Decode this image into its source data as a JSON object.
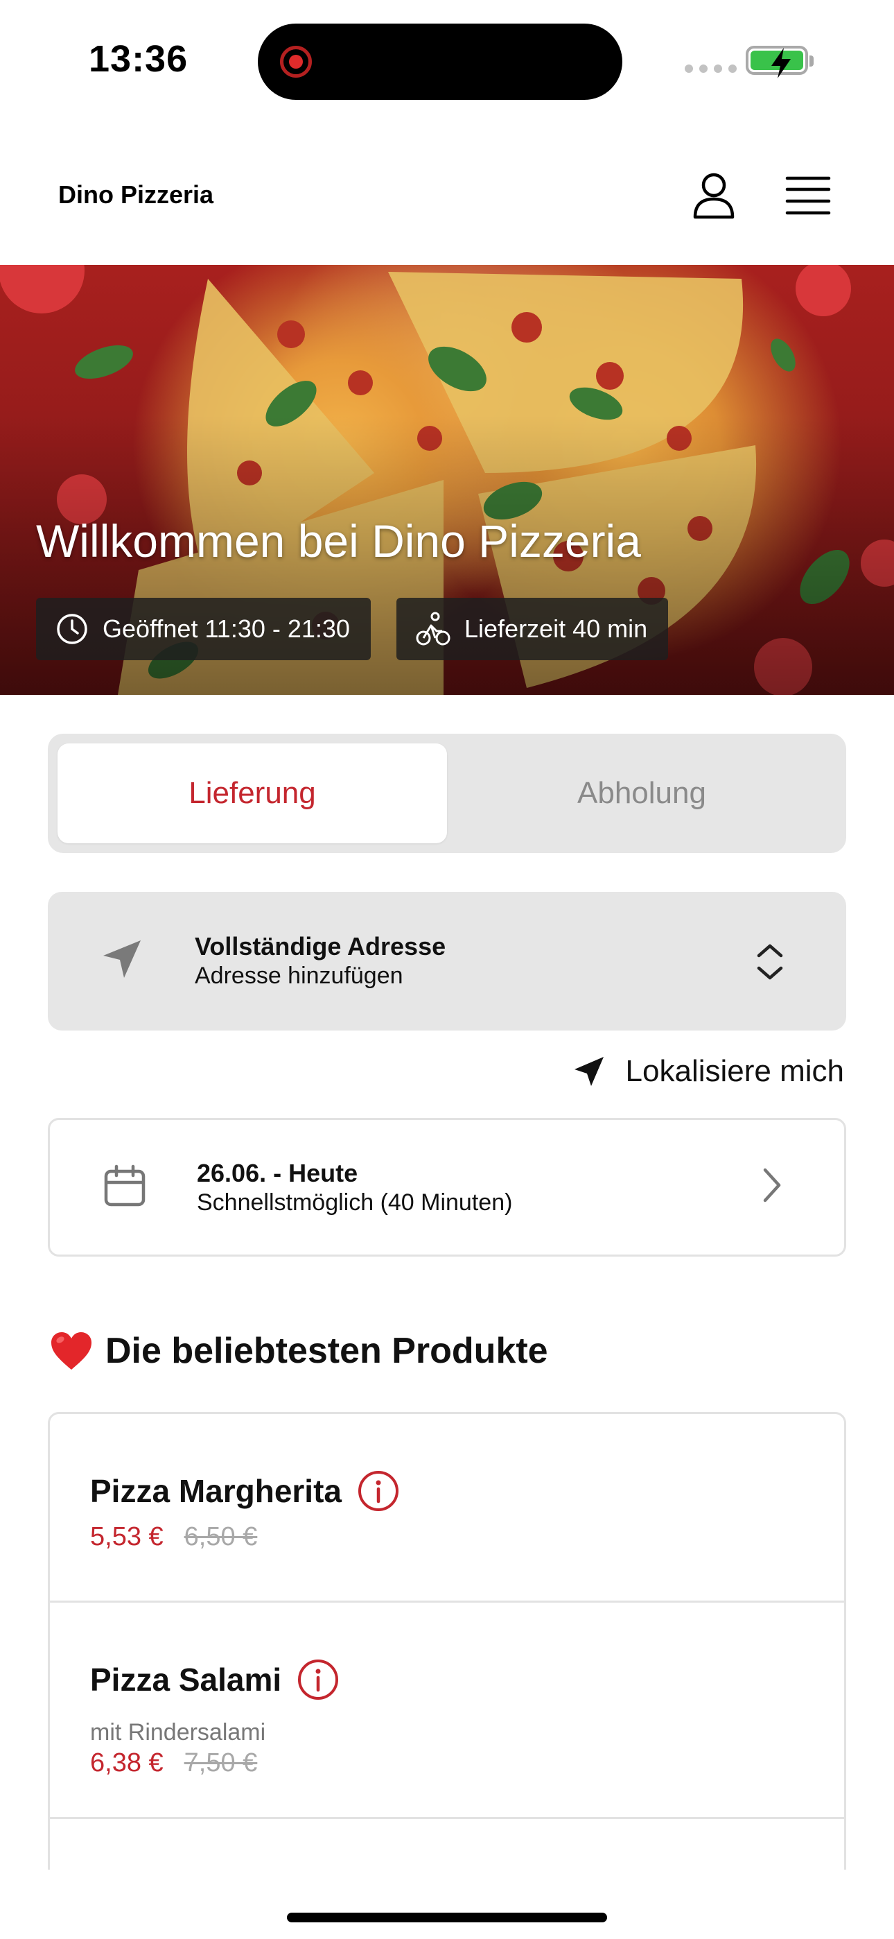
{
  "status_bar": {
    "time": "13:36"
  },
  "header": {
    "brand": "Dino Pizzeria"
  },
  "hero": {
    "title": "Willkommen bei Dino Pizzeria",
    "hours": "Geöffnet 11:30 - 21:30",
    "delivery_time": "Lieferzeit 40 min"
  },
  "order_mode": {
    "options": [
      "Lieferung",
      "Abholung"
    ],
    "selected": "Lieferung"
  },
  "address": {
    "title": "Vollständige Adresse",
    "subtitle": "Adresse hinzufügen"
  },
  "locate": {
    "label": "Lokalisiere mich"
  },
  "schedule": {
    "title": "26.06. - Heute",
    "subtitle": "Schnellstmöglich (40 Minuten)"
  },
  "popular": {
    "heading": "Die beliebtesten Produkte",
    "products": [
      {
        "name": "Pizza Margherita",
        "description": "",
        "price": "5,53 €",
        "old_price": "6,50 €"
      },
      {
        "name": "Pizza Salami",
        "description": "mit Rindersalami",
        "price": "6,38 €",
        "old_price": "7,50 €"
      }
    ]
  },
  "colors": {
    "accent": "#c4262e",
    "segment_bg": "#e6e6e6",
    "battery": "#39c24a"
  },
  "icons": [
    "user-icon",
    "menu-icon",
    "clock-icon",
    "bike-icon",
    "navigation-arrow-icon",
    "chevron-updown-icon",
    "calendar-icon",
    "chevron-right-icon",
    "heart-icon",
    "info-icon"
  ]
}
